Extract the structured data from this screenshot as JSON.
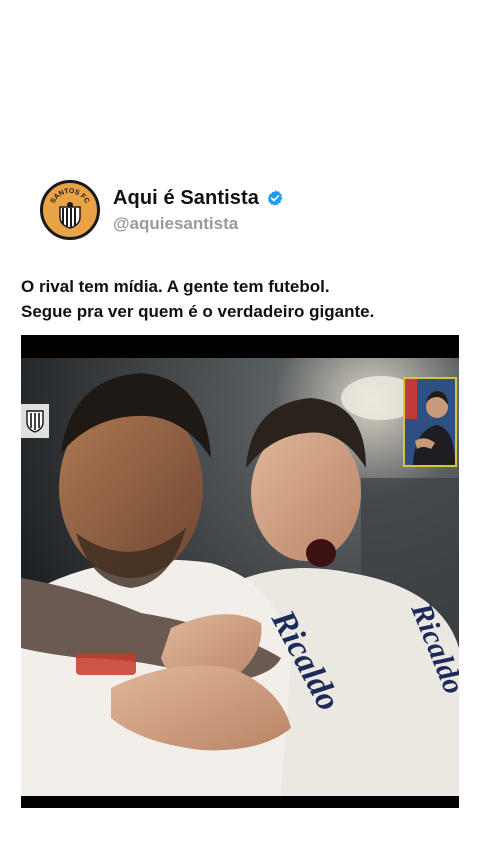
{
  "profile": {
    "display_name": "Aqui é Santista",
    "handle": "@aquiesantista",
    "avatar_text": "SANTOS FC",
    "verified": true
  },
  "caption": {
    "line1": "O rival tem mídia. A gente tem futebol.",
    "line2": "Segue pra ver quem é o verdadeiro gigante."
  },
  "video": {
    "jersey_text_1": "Ricaldo",
    "jersey_text_2": "Ricaldo"
  },
  "colors": {
    "verified_blue": "#1d9bf0",
    "avatar_gold": "#e9a246",
    "handle_gray": "#9a9a9a"
  }
}
